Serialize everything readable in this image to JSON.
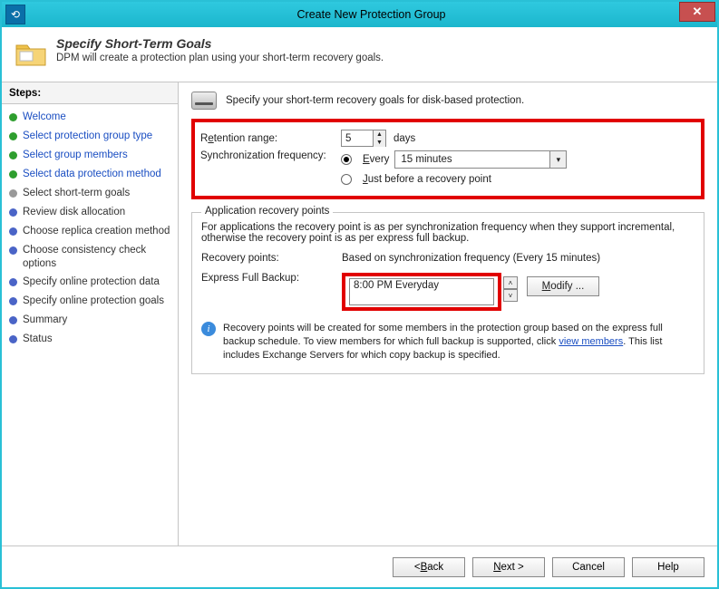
{
  "window": {
    "title": "Create New Protection Group",
    "close_glyph": "✕",
    "sys_glyph": "⟲"
  },
  "header": {
    "title": "Specify Short-Term Goals",
    "subtitle": "DPM will create a protection plan using your short-term recovery goals."
  },
  "steps": {
    "heading": "Steps:",
    "items": [
      {
        "label": "Welcome",
        "state": "done"
      },
      {
        "label": "Select protection group type",
        "state": "done"
      },
      {
        "label": "Select group members",
        "state": "done"
      },
      {
        "label": "Select data protection method",
        "state": "done"
      },
      {
        "label": "Select short-term goals",
        "state": "current"
      },
      {
        "label": "Review disk allocation",
        "state": "future"
      },
      {
        "label": "Choose replica creation method",
        "state": "future"
      },
      {
        "label": "Choose consistency check options",
        "state": "future"
      },
      {
        "label": "Specify online protection data",
        "state": "future"
      },
      {
        "label": "Specify online protection goals",
        "state": "future"
      },
      {
        "label": "Summary",
        "state": "future"
      },
      {
        "label": "Status",
        "state": "future"
      }
    ]
  },
  "content": {
    "intro": "Specify your short-term recovery goals for disk-based protection.",
    "retention_label_pre": "R",
    "retention_label_und": "e",
    "retention_label_post": "tention range:",
    "retention_value": "5",
    "retention_unit": "days",
    "sync_label": "Synchronization frequency:",
    "sync_every_pre": "",
    "sync_every_und": "E",
    "sync_every_post": "very",
    "sync_value": "15 minutes",
    "sync_just_pre": "",
    "sync_just_und": "J",
    "sync_just_post": "ust before a recovery point",
    "fieldset_legend": "Application recovery points",
    "fieldset_desc": "For applications the recovery point is as per synchronization frequency when they support incremental, otherwise the recovery point is as per express full backup.",
    "recovery_label": "Recovery points:",
    "recovery_value": "Based on synchronization frequency (Every 15 minutes)",
    "express_label": "Express Full Backup:",
    "express_value": "8:00 PM Everyday",
    "modify_pre": "",
    "modify_und": "M",
    "modify_post": "odify ...",
    "info_text_1": "Recovery points will be created for some members in the protection group based on the express full backup schedule. To view members for which full backup is supported, click ",
    "info_link": "view members",
    "info_text_2": ". This list includes Exchange Servers for which copy backup is specified."
  },
  "footer": {
    "back_pre": "< ",
    "back_und": "B",
    "back_post": "ack",
    "next_pre": "",
    "next_und": "N",
    "next_post": "ext >",
    "cancel": "Cancel",
    "help": "Help"
  }
}
